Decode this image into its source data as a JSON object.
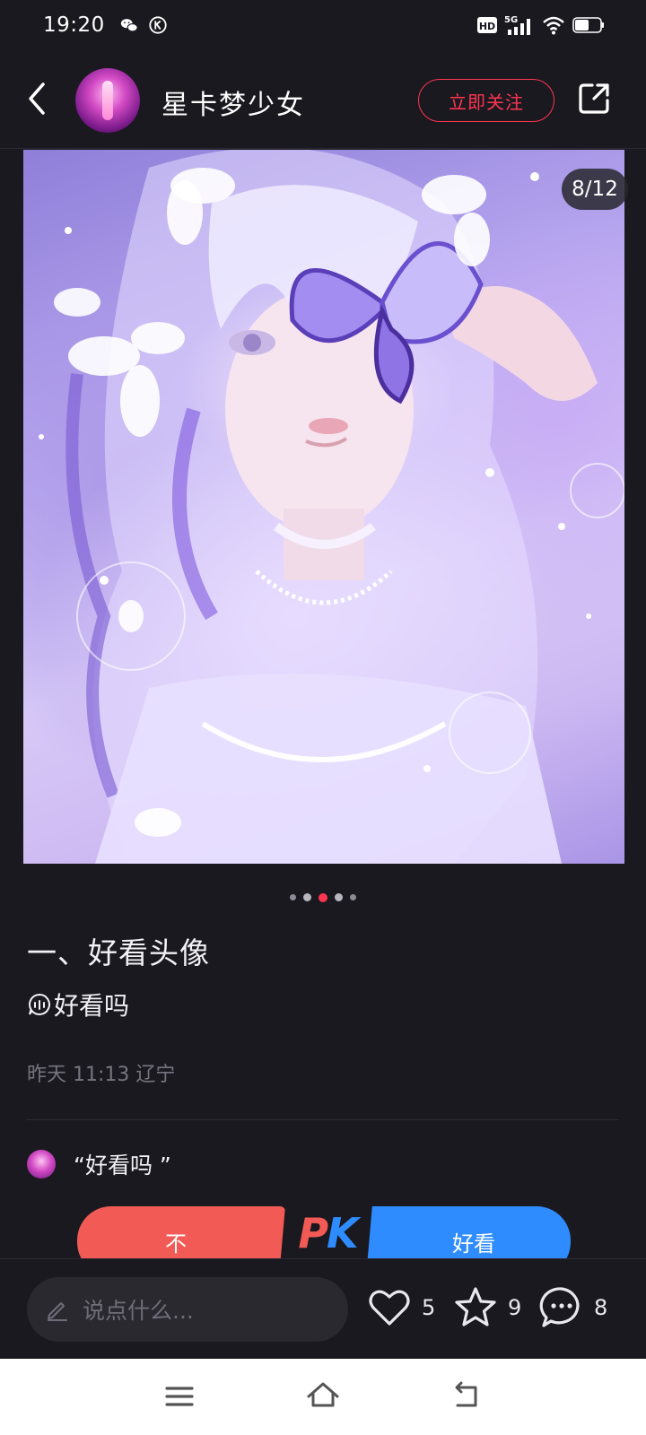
{
  "status_bar": {
    "time": "19:20",
    "icons_left": [
      "wechat-icon",
      "k-icon"
    ],
    "icons_right": [
      "hd-icon",
      "5g-signal-icon",
      "wifi-icon",
      "battery-icon"
    ],
    "network": "5G",
    "hd": "HD"
  },
  "header": {
    "username": "星卡梦少女",
    "follow_label": "立即关注",
    "accent": "#ff3550"
  },
  "post": {
    "page_indicator": "8/12",
    "title": "一、好看头像",
    "topic": "好看吗",
    "meta": "昨天 11:13 辽宁"
  },
  "vote": {
    "question": "“好看吗 ”",
    "left_option": "不",
    "right_option": "好看",
    "pk_p": "P",
    "pk_k": "K",
    "left_color": "#f25b55",
    "right_color": "#2f8cff"
  },
  "action_bar": {
    "comment_placeholder": "说点什么...",
    "likes": "5",
    "favorites": "9",
    "comments": "8"
  },
  "nav": {
    "buttons": [
      "menu-icon",
      "home-icon",
      "back-icon"
    ]
  }
}
